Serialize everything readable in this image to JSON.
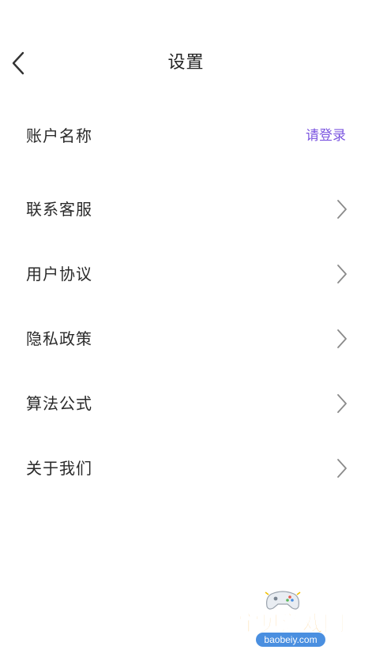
{
  "header": {
    "title": "设置"
  },
  "settings": [
    {
      "label": "账户名称",
      "value": "请登录"
    },
    {
      "label": "联系客服"
    },
    {
      "label": "用户协议"
    },
    {
      "label": "隐私政策"
    },
    {
      "label": "算法公式"
    },
    {
      "label": "关于我们"
    }
  ],
  "watermark": {
    "title": "宝贝游戏网",
    "url": "baobeiy.com"
  },
  "colors": {
    "accent": "#7b55e0",
    "text": "#2a2a2a",
    "chevron": "#8a8a8a"
  }
}
